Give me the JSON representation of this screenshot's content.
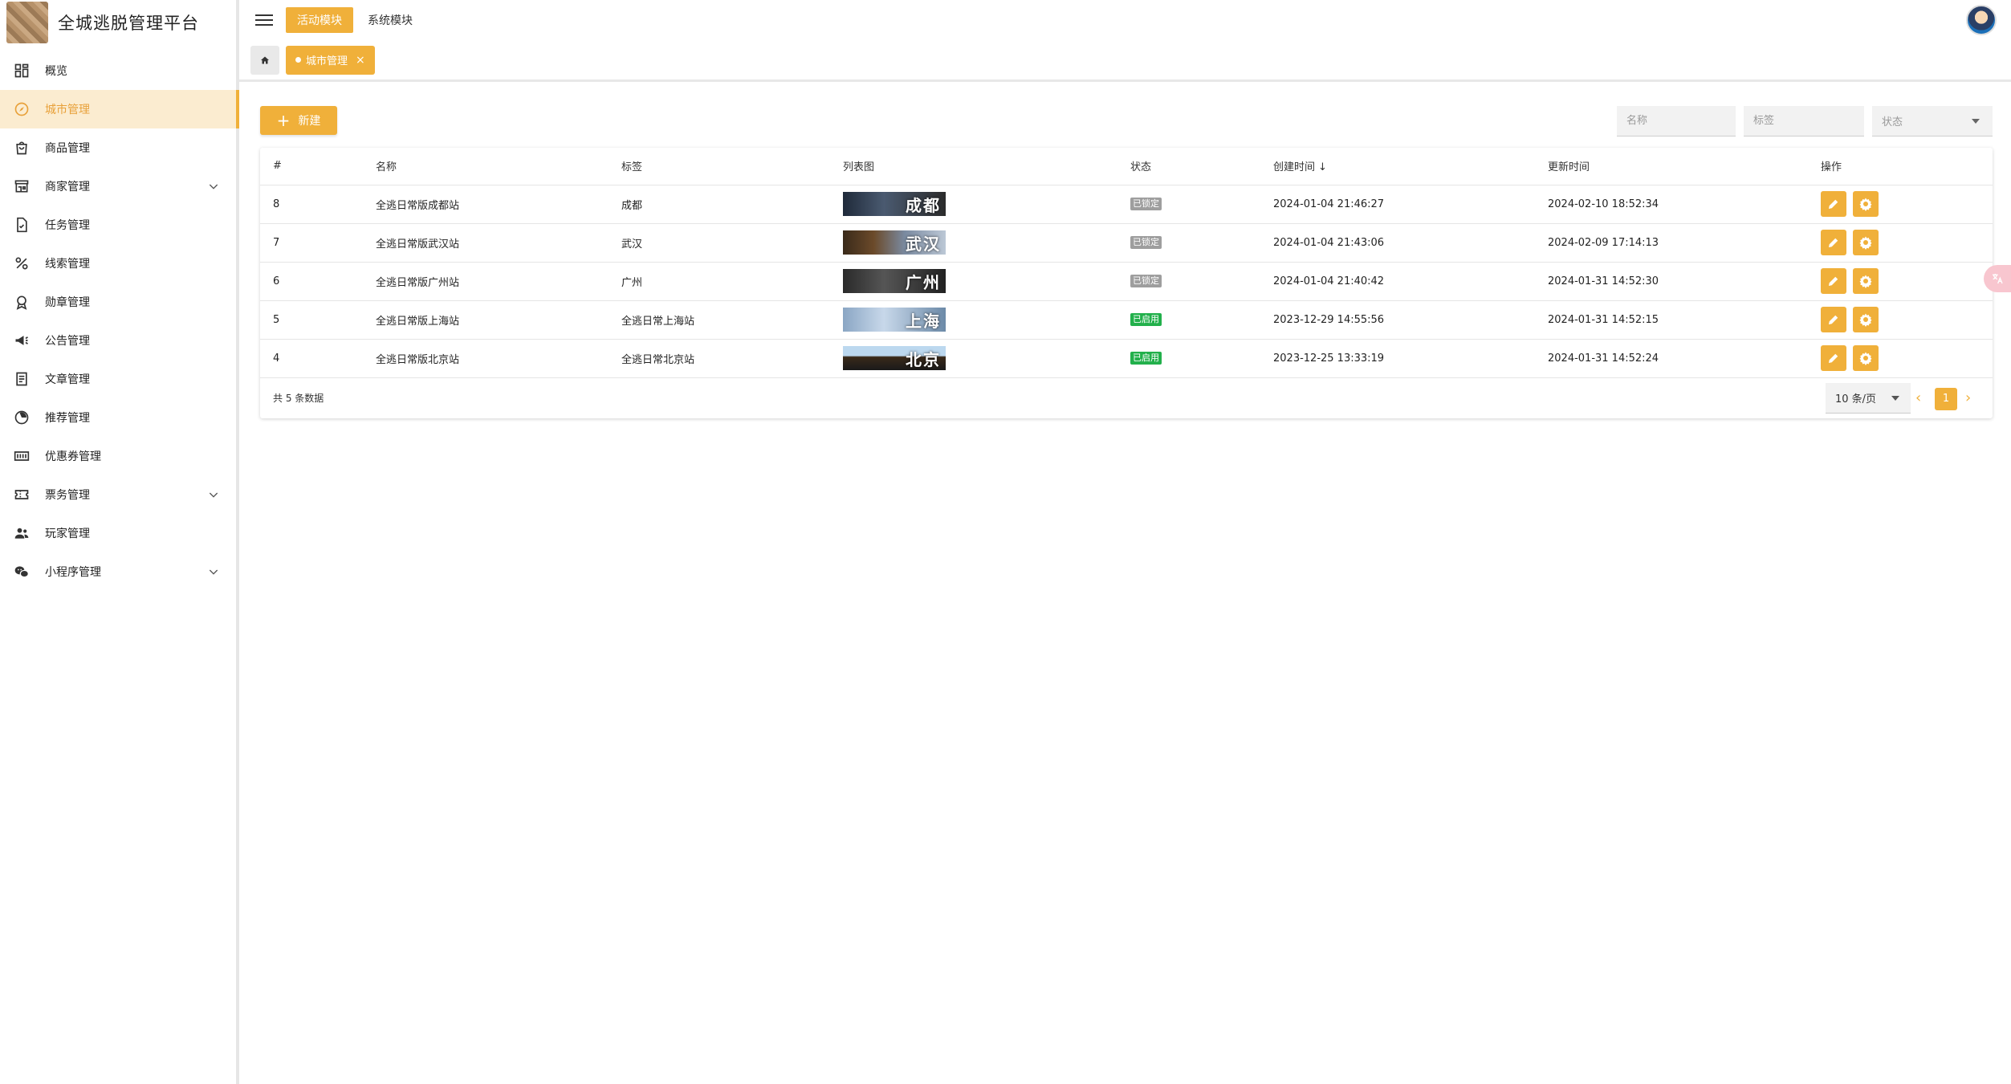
{
  "brand": {
    "title": "全城逃脱管理平台"
  },
  "sidebar": {
    "items": [
      {
        "label": "概览",
        "icon": "dashboard-icon"
      },
      {
        "label": "城市管理",
        "icon": "compass-icon",
        "active": true
      },
      {
        "label": "商品管理",
        "icon": "shopping-bag-icon"
      },
      {
        "label": "商家管理",
        "icon": "store-icon",
        "expandable": true
      },
      {
        "label": "任务管理",
        "icon": "task-document-icon"
      },
      {
        "label": "线索管理",
        "icon": "percent-icon"
      },
      {
        "label": "勋章管理",
        "icon": "medal-icon"
      },
      {
        "label": "公告管理",
        "icon": "megaphone-icon"
      },
      {
        "label": "文章管理",
        "icon": "article-icon"
      },
      {
        "label": "推荐管理",
        "icon": "recommend-icon"
      },
      {
        "label": "优惠券管理",
        "icon": "coupon-icon"
      },
      {
        "label": "票务管理",
        "icon": "ticket-icon",
        "expandable": true
      },
      {
        "label": "玩家管理",
        "icon": "players-icon"
      },
      {
        "label": "小程序管理",
        "icon": "wechat-icon",
        "expandable": true
      }
    ]
  },
  "topbar": {
    "modules": [
      {
        "label": "活动模块",
        "active": true
      },
      {
        "label": "系统模块",
        "active": false
      }
    ]
  },
  "tabs": {
    "current": "城市管理"
  },
  "toolbar": {
    "new_label": "新建",
    "filters": {
      "name_placeholder": "名称",
      "tag_placeholder": "标签",
      "status_placeholder": "状态"
    }
  },
  "table": {
    "headers": {
      "id": "#",
      "name": "名称",
      "tag": "标签",
      "image": "列表图",
      "status": "状态",
      "created": "创建时间",
      "updated": "更新时间",
      "actions": "操作"
    },
    "sort_indicator": "↓",
    "rows": [
      {
        "id": "8",
        "name": "全逃日常版成都站",
        "tag": "成都",
        "image_text": "成都",
        "status": "已锁定",
        "created": "2024-01-04 21:46:27",
        "updated": "2024-02-10 18:52:34"
      },
      {
        "id": "7",
        "name": "全逃日常版武汉站",
        "tag": "武汉",
        "image_text": "武汉",
        "status": "已锁定",
        "created": "2024-01-04 21:43:06",
        "updated": "2024-02-09 17:14:13"
      },
      {
        "id": "6",
        "name": "全逃日常版广州站",
        "tag": "广州",
        "image_text": "广州",
        "status": "已锁定",
        "created": "2024-01-04 21:40:42",
        "updated": "2024-01-31 14:52:30"
      },
      {
        "id": "5",
        "name": "全逃日常版上海站",
        "tag": "全逃日常上海站",
        "image_text": "上海",
        "status": "已启用",
        "created": "2023-12-29 14:55:56",
        "updated": "2024-01-31 14:52:15"
      },
      {
        "id": "4",
        "name": "全逃日常版北京站",
        "tag": "全逃日常北京站",
        "image_text": "北京",
        "status": "已启用",
        "created": "2023-12-25 13:33:19",
        "updated": "2024-01-31 14:52:24"
      }
    ]
  },
  "footer": {
    "total": "共 5 条数据",
    "page_size": "10 条/页",
    "current_page": "1"
  },
  "colors": {
    "accent": "#f0b03a",
    "locked": "#9e9e9e",
    "enabled": "#22b04b"
  }
}
